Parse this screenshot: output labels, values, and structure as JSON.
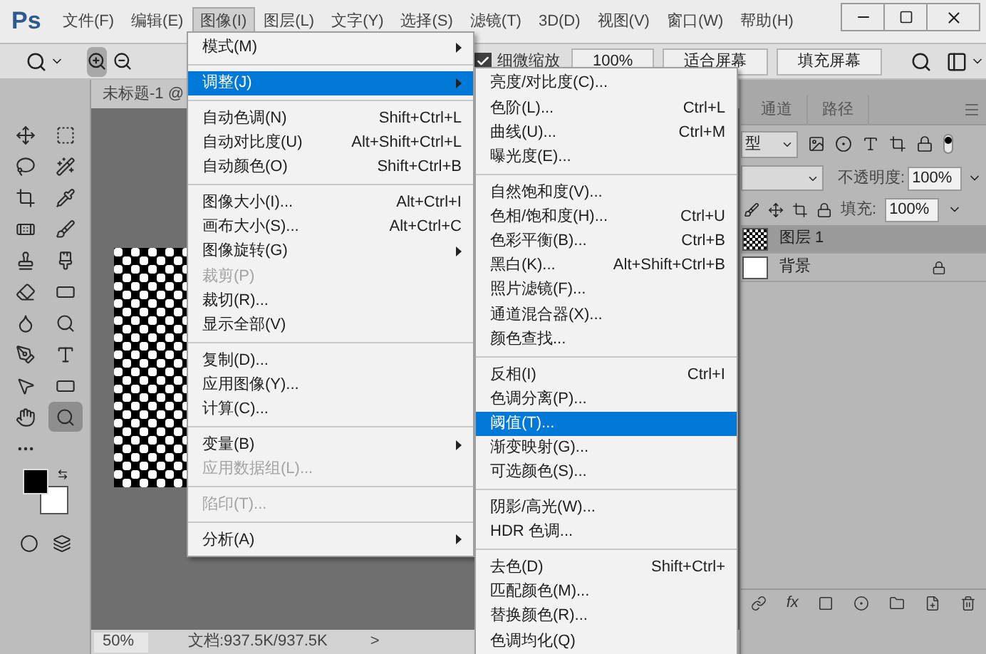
{
  "app": {
    "logo": "Ps"
  },
  "menu_bar": [
    {
      "label": "文件(F)",
      "selected": false
    },
    {
      "label": "编辑(E)",
      "selected": false
    },
    {
      "label": "图像(I)",
      "selected": true
    },
    {
      "label": "图层(L)",
      "selected": false
    },
    {
      "label": "文字(Y)",
      "selected": false
    },
    {
      "label": "选择(S)",
      "selected": false
    },
    {
      "label": "滤镜(T)",
      "selected": false
    },
    {
      "label": "3D(D)",
      "selected": false
    },
    {
      "label": "视图(V)",
      "selected": false
    },
    {
      "label": "窗口(W)",
      "selected": false
    },
    {
      "label": "帮助(H)",
      "selected": false
    }
  ],
  "options_bar": {
    "fine_zoom": {
      "label": "细微缩放",
      "checked": true
    },
    "buttons": [
      "100%",
      "适合屏幕",
      "填充屏幕"
    ]
  },
  "document": {
    "tab_title": "未标题-1 @",
    "zoom": "50%",
    "doc_info": "文档:937.5K/937.5K",
    "arrow": ">"
  },
  "image_menu": {
    "items": [
      {
        "kind": "item",
        "label": "模式(M)",
        "submenu": true,
        "selected": false,
        "disabled": false
      },
      {
        "kind": "separator"
      },
      {
        "kind": "item",
        "label": "调整(J)",
        "submenu": true,
        "selected": true,
        "disabled": false
      },
      {
        "kind": "separator"
      },
      {
        "kind": "item",
        "label": "自动色调(N)",
        "shortcut": "Shift+Ctrl+L",
        "submenu": false,
        "selected": false,
        "disabled": false
      },
      {
        "kind": "item",
        "label": "自动对比度(U)",
        "shortcut": "Alt+Shift+Ctrl+L",
        "submenu": false,
        "selected": false,
        "disabled": false
      },
      {
        "kind": "item",
        "label": "自动颜色(O)",
        "shortcut": "Shift+Ctrl+B",
        "submenu": false,
        "selected": false,
        "disabled": false
      },
      {
        "kind": "separator"
      },
      {
        "kind": "item",
        "label": "图像大小(I)...",
        "shortcut": "Alt+Ctrl+I",
        "submenu": false,
        "selected": false,
        "disabled": false
      },
      {
        "kind": "item",
        "label": "画布大小(S)...",
        "shortcut": "Alt+Ctrl+C",
        "submenu": false,
        "selected": false,
        "disabled": false
      },
      {
        "kind": "item",
        "label": "图像旋转(G)",
        "submenu": true,
        "selected": false,
        "disabled": false
      },
      {
        "kind": "item",
        "label": "裁剪(P)",
        "submenu": false,
        "selected": false,
        "disabled": true
      },
      {
        "kind": "item",
        "label": "裁切(R)...",
        "submenu": false,
        "selected": false,
        "disabled": false
      },
      {
        "kind": "item",
        "label": "显示全部(V)",
        "submenu": false,
        "selected": false,
        "disabled": false
      },
      {
        "kind": "separator"
      },
      {
        "kind": "item",
        "label": "复制(D)...",
        "submenu": false,
        "selected": false,
        "disabled": false
      },
      {
        "kind": "item",
        "label": "应用图像(Y)...",
        "submenu": false,
        "selected": false,
        "disabled": false
      },
      {
        "kind": "item",
        "label": "计算(C)...",
        "submenu": false,
        "selected": false,
        "disabled": false
      },
      {
        "kind": "separator"
      },
      {
        "kind": "item",
        "label": "变量(B)",
        "submenu": true,
        "selected": false,
        "disabled": false
      },
      {
        "kind": "item",
        "label": "应用数据组(L)...",
        "submenu": false,
        "selected": false,
        "disabled": true
      },
      {
        "kind": "separator"
      },
      {
        "kind": "item",
        "label": "陷印(T)...",
        "submenu": false,
        "selected": false,
        "disabled": true
      },
      {
        "kind": "separator"
      },
      {
        "kind": "item",
        "label": "分析(A)",
        "submenu": true,
        "selected": false,
        "disabled": false
      }
    ]
  },
  "adjust_menu": {
    "items": [
      {
        "kind": "item",
        "label": "亮度/对比度(C)...",
        "submenu": false,
        "selected": false,
        "disabled": false
      },
      {
        "kind": "item",
        "label": "色阶(L)...",
        "shortcut": "Ctrl+L",
        "submenu": false,
        "selected": false,
        "disabled": false
      },
      {
        "kind": "item",
        "label": "曲线(U)...",
        "shortcut": "Ctrl+M",
        "submenu": false,
        "selected": false,
        "disabled": false
      },
      {
        "kind": "item",
        "label": "曝光度(E)...",
        "submenu": false,
        "selected": false,
        "disabled": false
      },
      {
        "kind": "separator"
      },
      {
        "kind": "item",
        "label": "自然饱和度(V)...",
        "submenu": false,
        "selected": false,
        "disabled": false
      },
      {
        "kind": "item",
        "label": "色相/饱和度(H)...",
        "shortcut": "Ctrl+U",
        "submenu": false,
        "selected": false,
        "disabled": false
      },
      {
        "kind": "item",
        "label": "色彩平衡(B)...",
        "shortcut": "Ctrl+B",
        "submenu": false,
        "selected": false,
        "disabled": false
      },
      {
        "kind": "item",
        "label": "黑白(K)...",
        "shortcut": "Alt+Shift+Ctrl+B",
        "submenu": false,
        "selected": false,
        "disabled": false
      },
      {
        "kind": "item",
        "label": "照片滤镜(F)...",
        "submenu": false,
        "selected": false,
        "disabled": false
      },
      {
        "kind": "item",
        "label": "通道混合器(X)...",
        "submenu": false,
        "selected": false,
        "disabled": false
      },
      {
        "kind": "item",
        "label": "颜色查找...",
        "submenu": false,
        "selected": false,
        "disabled": false
      },
      {
        "kind": "separator"
      },
      {
        "kind": "item",
        "label": "反相(I)",
        "shortcut": "Ctrl+I",
        "submenu": false,
        "selected": false,
        "disabled": false
      },
      {
        "kind": "item",
        "label": "色调分离(P)...",
        "submenu": false,
        "selected": false,
        "disabled": false
      },
      {
        "kind": "item",
        "label": "阈值(T)...",
        "submenu": false,
        "selected": true,
        "disabled": false
      },
      {
        "kind": "item",
        "label": "渐变映射(G)...",
        "submenu": false,
        "selected": false,
        "disabled": false
      },
      {
        "kind": "item",
        "label": "可选颜色(S)...",
        "submenu": false,
        "selected": false,
        "disabled": false
      },
      {
        "kind": "separator"
      },
      {
        "kind": "item",
        "label": "阴影/高光(W)...",
        "submenu": false,
        "selected": false,
        "disabled": false
      },
      {
        "kind": "item",
        "label": "HDR 色调...",
        "submenu": false,
        "selected": false,
        "disabled": false
      },
      {
        "kind": "separator"
      },
      {
        "kind": "item",
        "label": "去色(D)",
        "shortcut": "Shift+Ctrl+",
        "submenu": false,
        "selected": false,
        "disabled": false
      },
      {
        "kind": "item",
        "label": "匹配颜色(M)...",
        "submenu": false,
        "selected": false,
        "disabled": false
      },
      {
        "kind": "item",
        "label": "替换颜色(R)...",
        "submenu": false,
        "selected": false,
        "disabled": false
      },
      {
        "kind": "item",
        "label": "色调均化(Q)",
        "submenu": false,
        "selected": false,
        "disabled": false
      }
    ]
  },
  "layers_panel": {
    "tabs": [
      {
        "label": "通道",
        "selected": false
      },
      {
        "label": "路径",
        "selected": false
      }
    ],
    "filter_kind": "型",
    "opacity_label": "不透明度:",
    "opacity": "100%",
    "fill_label": "填充:",
    "fill": "100%",
    "layers": [
      {
        "name": "图层 1",
        "selected": true,
        "locked": false,
        "transparent": true
      },
      {
        "name": "背景",
        "selected": false,
        "locked": true,
        "transparent": false
      }
    ],
    "style_button": "fx"
  }
}
